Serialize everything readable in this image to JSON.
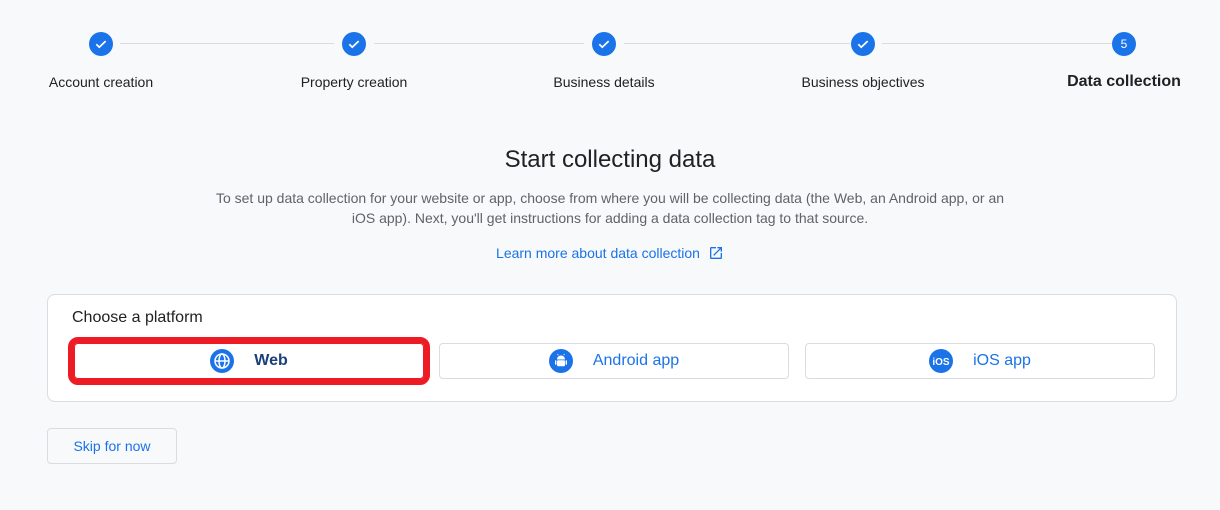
{
  "stepper": {
    "steps": [
      {
        "label": "Account creation",
        "state": "done"
      },
      {
        "label": "Property creation",
        "state": "done"
      },
      {
        "label": "Business details",
        "state": "done"
      },
      {
        "label": "Business objectives",
        "state": "done"
      },
      {
        "label": "Data collection",
        "state": "active",
        "number": "5"
      }
    ]
  },
  "main": {
    "title": "Start collecting data",
    "description": "To set up data collection for your website or app, choose from where you will be collecting data (the Web, an Android app, or an iOS app). Next, you'll get instructions for adding a data collection tag to that source.",
    "learn_more": "Learn more about data collection"
  },
  "platform": {
    "heading": "Choose a platform",
    "options": [
      {
        "label": "Web",
        "icon": "globe-icon",
        "selected": true
      },
      {
        "label": "Android app",
        "icon": "android-icon",
        "selected": false
      },
      {
        "label": "iOS app",
        "icon": "ios-icon",
        "selected": false
      }
    ]
  },
  "footer": {
    "skip_label": "Skip for now"
  },
  "colors": {
    "accent": "#1a73e8",
    "highlight": "#ed1c24"
  }
}
